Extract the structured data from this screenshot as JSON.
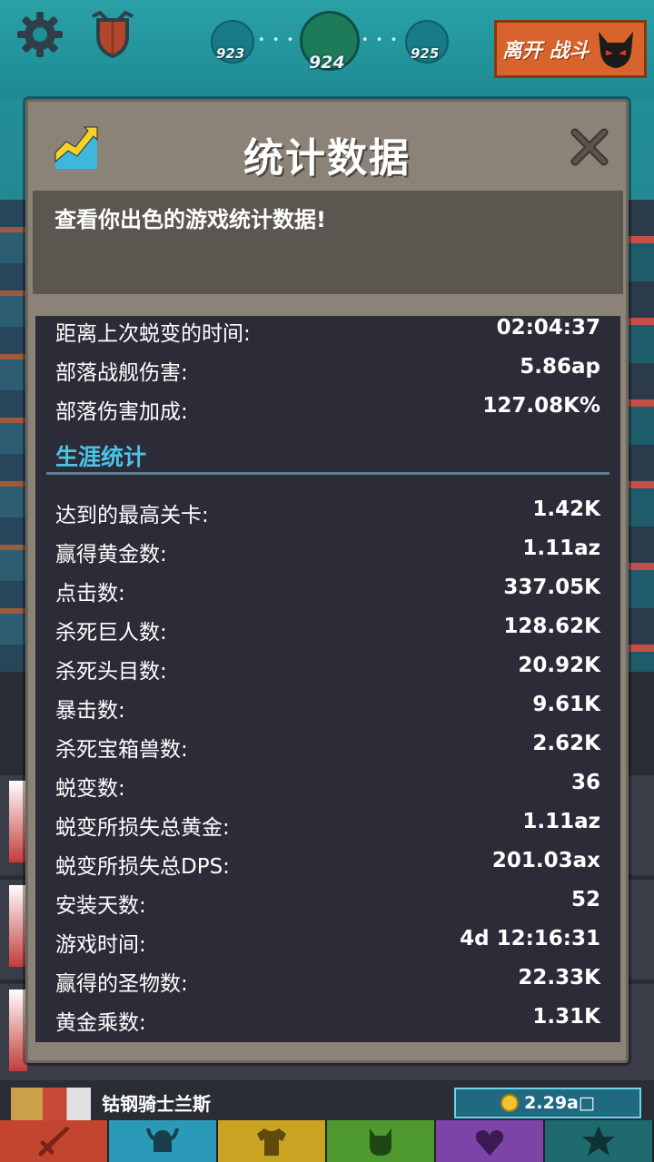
{
  "hud": {
    "stages": {
      "prev": "923",
      "current": "924",
      "next": "925"
    },
    "leave_fight_label": "离开 战斗"
  },
  "modal": {
    "title": "统计数据",
    "description": "查看你出色的游戏统计数据!",
    "current_stats": [
      {
        "label": "距离上次蜕变的时间:",
        "value": "02:04:37"
      },
      {
        "label": "部落战舰伤害:",
        "value": "5.86ap"
      },
      {
        "label": "部落伤害加成:",
        "value": "127.08K%"
      }
    ],
    "career_heading": "生涯统计",
    "career_stats": [
      {
        "label": "达到的最高关卡:",
        "value": "1.42K"
      },
      {
        "label": "赢得黄金数:",
        "value": "1.11az"
      },
      {
        "label": "点击数:",
        "value": "337.05K"
      },
      {
        "label": "杀死巨人数:",
        "value": "128.62K"
      },
      {
        "label": "杀死头目数:",
        "value": "20.92K"
      },
      {
        "label": "暴击数:",
        "value": "9.61K"
      },
      {
        "label": "杀死宝箱兽数:",
        "value": "2.62K"
      },
      {
        "label": "蜕变数:",
        "value": "36"
      },
      {
        "label": "蜕变所损失总黄金:",
        "value": "1.11az"
      },
      {
        "label": "蜕变所损失总DPS:",
        "value": "201.03ax"
      },
      {
        "label": "安装天数:",
        "value": "52"
      },
      {
        "label": "游戏时间:",
        "value": "4d 12:16:31"
      },
      {
        "label": "赢得的圣物数:",
        "value": "22.33K"
      },
      {
        "label": "黄金乘数:",
        "value": "1.31K"
      }
    ]
  },
  "bottom": {
    "hero_name": "钴钢骑士兰斯",
    "gold_value": "2.29a□",
    "tabs": [
      {
        "icon": "sword-icon",
        "color": "#c4452f"
      },
      {
        "icon": "viking-helmet-icon",
        "color": "#2b9ab8"
      },
      {
        "icon": "shirt-icon",
        "color": "#c9a321"
      },
      {
        "icon": "pet-icon",
        "color": "#4f9a2f"
      },
      {
        "icon": "heart-emblem-icon",
        "color": "#7d44a8"
      },
      {
        "icon": "star-icon",
        "color": "#1f6a6e"
      }
    ]
  }
}
